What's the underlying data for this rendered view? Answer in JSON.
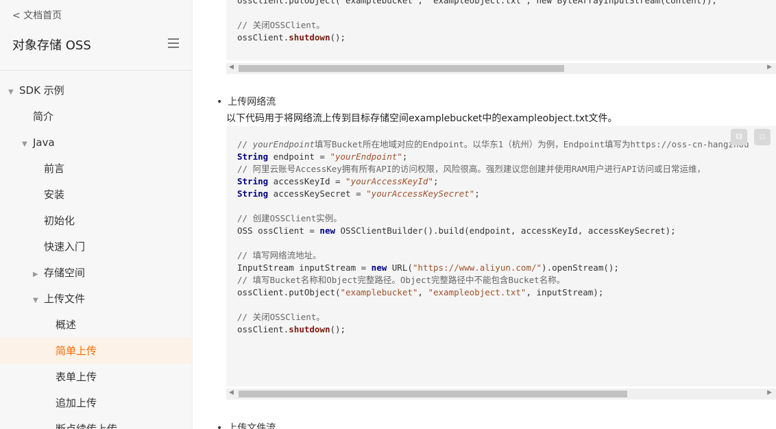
{
  "sidebar": {
    "back_label": "< 文档首页",
    "title": "对象存储 OSS",
    "items": [
      {
        "label": "SDK 示例",
        "arrow": "▼"
      },
      {
        "label": "简介",
        "arrow": ""
      },
      {
        "label": "Java",
        "arrow": "▼"
      },
      {
        "label": "前言",
        "arrow": ""
      },
      {
        "label": "安装",
        "arrow": ""
      },
      {
        "label": "初始化",
        "arrow": ""
      },
      {
        "label": "快速入门",
        "arrow": ""
      },
      {
        "label": "存储空间",
        "arrow": "▶"
      },
      {
        "label": "上传文件",
        "arrow": "▼"
      },
      {
        "label": "概述",
        "arrow": ""
      },
      {
        "label": "简单上传",
        "arrow": ""
      },
      {
        "label": "表单上传",
        "arrow": ""
      },
      {
        "label": "追加上传",
        "arrow": ""
      },
      {
        "label": "断点续传上传",
        "arrow": ""
      }
    ]
  },
  "block1": {
    "line0": "ossClient.putObject(\"examplebucket\", \"exampleobject.txt\", new ByteArrayInputStream(content));",
    "comment": "// 关闭OSSClient。",
    "call_obj": "ossClient.",
    "call_fn": "shutdown",
    "call_end": "();"
  },
  "section2": {
    "bullet": "上传网络流",
    "desc": "以下代码用于将网络流上传到目标存储空间examplebucket中的exampleobject.txt文件。"
  },
  "block2": {
    "c1_pre": "// ",
    "c1_it": "yourEndpoint",
    "c1_post": "填写Bucket所在地域对应的Endpoint。以华东1（杭州）为例，Endpoint填写为https://oss-cn-hangzhou",
    "l2_kw": "String",
    "l2_mid": " endpoint = ",
    "l2_str": "\"yourEndpoint\"",
    "l2_end": ";",
    "c3": "// 阿里云账号AccessKey拥有所有API的访问权限，风险很高。强烈建议您创建并使用RAM用户进行API访问或日常运维，",
    "l4_kw": "String",
    "l4_mid": " accessKeyId = ",
    "l4_str": "\"yourAccessKeyId\"",
    "l4_end": ";",
    "l5_kw": "String",
    "l5_mid": " accessKeySecret = ",
    "l5_str": "\"yourAccessKeySecret\"",
    "l5_end": ";",
    "c6": "// 创建OSSClient实例。",
    "l7_pre": "OSS ossClient = ",
    "l7_kw": "new",
    "l7_post": " OSSClientBuilder().build(endpoint, accessKeyId, accessKeySecret);",
    "c8": "// 填写网络流地址。",
    "l9_pre": "InputStream inputStream = ",
    "l9_kw": "new",
    "l9_mid": " URL(",
    "l9_str": "\"https://www.aliyun.com/\"",
    "l9_end": ").openStream();",
    "c10": "// 填写Bucket名称和Object完整路径。Object完整路径中不能包含Bucket名称。",
    "l11_pre": "ossClient.putObject(",
    "l11_s1": "\"examplebucket\"",
    "l11_sep": ", ",
    "l11_s2": "\"exampleobject.txt\"",
    "l11_end": ", inputStream);",
    "c12": "// 关闭OSSClient。",
    "l13_obj": "ossClient.",
    "l13_fn": "shutdown",
    "l13_end": "();"
  },
  "section3": {
    "bullet": "上传文件流"
  },
  "scroll1": {
    "position": 0.62
  },
  "scroll2": {
    "position": 0.74
  }
}
